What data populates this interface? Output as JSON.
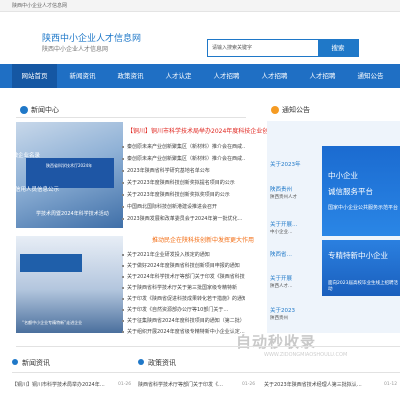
{
  "topbar": {
    "text": "陕西中小企业人才信息网"
  },
  "header": {
    "site_name": "陕西中小企业人才信息网",
    "site_sub": "陕西中小企业人才信息网",
    "search_placeholder": "请输入搜索关键字",
    "search_button": "搜索"
  },
  "nav": {
    "items": [
      {
        "label": "网站首页"
      },
      {
        "label": "新闻资讯"
      },
      {
        "label": "政策资讯"
      },
      {
        "label": "人才认定"
      },
      {
        "label": "人才招聘"
      },
      {
        "label": "人才招聘"
      },
      {
        "label": "人才招聘"
      },
      {
        "label": "通知公告"
      }
    ]
  },
  "news_center": {
    "title": "新闻中心",
    "tag1": "小微企业名录",
    "side_tags": "挤抗信用人员信息公示",
    "screen_text": "陕西省科学技术厅2024年",
    "feature_label": "学技术周暨2024年科学技术活动",
    "feature2_caption": "“名额中小企业专精特新”走进企业",
    "headline1": "【铜川】铜川市科学技术局举办2024年度科技企业创",
    "items1": [
      {
        "text": "秦创原未来产业创新聚集区（新材料）推介会在西咸…",
        "date": ""
      },
      {
        "text": "秦创原未来产业创新聚集区（新材料）推介会在西咸…",
        "date": ""
      },
      {
        "text": "2023年陕西省科学研究基地名单公布",
        "date": ""
      },
      {
        "text": "关于2023年度陕西科技创新奖拟提名项目的公示",
        "date": ""
      },
      {
        "text": "关于2023年度陕西科技创新奖拟奖项目的公示",
        "date": ""
      },
      {
        "text": "中国西北国际科技创新港建设推进会召开",
        "date": ""
      },
      {
        "text": "2023陕西发展和改革委员会于2024年第一批优化…",
        "date": ""
      }
    ],
    "headline2": "推动民企在陕科技创新中发挥更大作用",
    "items2": [
      {
        "text": "关于2021年企业研发投入核定的通知",
        "date": ""
      },
      {
        "text": "关于做好2024年度陕西省科技创新项目申报的通知",
        "date": ""
      },
      {
        "text": "关于2024年科学技术厅等部门关于印发《陕西省科技…",
        "date": ""
      },
      {
        "text": "关于陕西省科学技术厅关于第三批国家级专精特新",
        "date": ""
      },
      {
        "text": "关于印发《陕西省促进科技成果转化若干措施》的通知",
        "date": ""
      },
      {
        "text": "关于印发《自然资源部办公厅等10部门关于…",
        "date": ""
      },
      {
        "text": "关于征集陕西省2024年度科技项目的通知（第二批）",
        "date": ""
      },
      {
        "text": "关于组织开展2024年度省级专精特新中小企业认定…",
        "date": ""
      },
      {
        "text": "关于陕西省科学技术厅拟立项项目公示的公告",
        "date": ""
      }
    ]
  },
  "notice": {
    "title": "通知公告",
    "items": [
      {
        "text": "关于2023年",
        "sub": ""
      },
      {
        "text": "陕西贵州",
        "sub": "陕西贵州人才"
      },
      {
        "text": "关于开展…",
        "sub": "中小企业…"
      },
      {
        "text": "陕西省…",
        "sub": ""
      },
      {
        "text": "关于开展",
        "sub": "陕西人才…"
      },
      {
        "text": "关于2023",
        "sub": "陕西贵州"
      }
    ],
    "img1_t1": "中小企业",
    "img1_t2": "诚信服务平台",
    "img1_t3": "国家中小企业公共服务示范平台",
    "img2_t1": "专精特新中小企业",
    "img2_t2": "",
    "img2_t3": "面向2023届高校毕业生线上招聘活动"
  },
  "bottom": {
    "news_title": "新闻资讯",
    "policy_title": "政策资讯",
    "news_item": "【铜川】铜川市科学技术局举办2024年…",
    "news_date": "01-26",
    "policy_item": "陕西省科学技术厅等部门关于印发《…",
    "policy_date": "01-26",
    "right_item": "关于2023年陕西省技术经理人第三批拟认…",
    "right_date": "01-12"
  },
  "watermark": {
    "text": "自动秒收录",
    "sub": "WWW.ZIDONGMIAOSHOULU.COM"
  },
  "colors": {
    "brand": "#1f78c8",
    "nav": "#1f6fc4",
    "nav_active": "#1557a3",
    "headline": "#e0261f",
    "headline_alt": "#f36c12"
  }
}
